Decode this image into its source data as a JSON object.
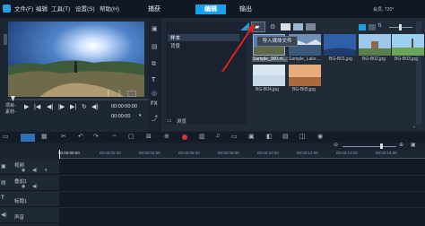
{
  "menu": [
    "文件(F)",
    "编辑",
    "工具(T)",
    "设置(S)",
    "帮助(H)"
  ],
  "tabs": [
    "捕获",
    "编辑",
    "输出"
  ],
  "version": "会员, 720°",
  "project_label": "项目-",
  "clip_label": "素材-",
  "timecode_top": "00:00:00:00",
  "timecode_bottom": "00:00:00",
  "add_label": "添加",
  "nav_items": [
    "样本",
    "背景"
  ],
  "browse_label": "浏览",
  "tooltip": "导入媒体文件",
  "thumbs": [
    "Sample_360.m...",
    "Sample_Lake....",
    "BG-B01.jpg",
    "BG-B02.jpg",
    "BG-B03.jpg",
    "BG-B04.jpg",
    "BG-B05.jpg"
  ],
  "ruler_marks": [
    "00:00:00:00",
    "00:00:02:00",
    "00:00:04:00",
    "00:00:06:00",
    "00:00:08:00",
    "00:00:10:00",
    "00:00:12:00",
    "00:00:14:00",
    "00:00:16:00"
  ],
  "tracks": [
    "视频",
    "叠加1",
    "标题1",
    "声音"
  ]
}
